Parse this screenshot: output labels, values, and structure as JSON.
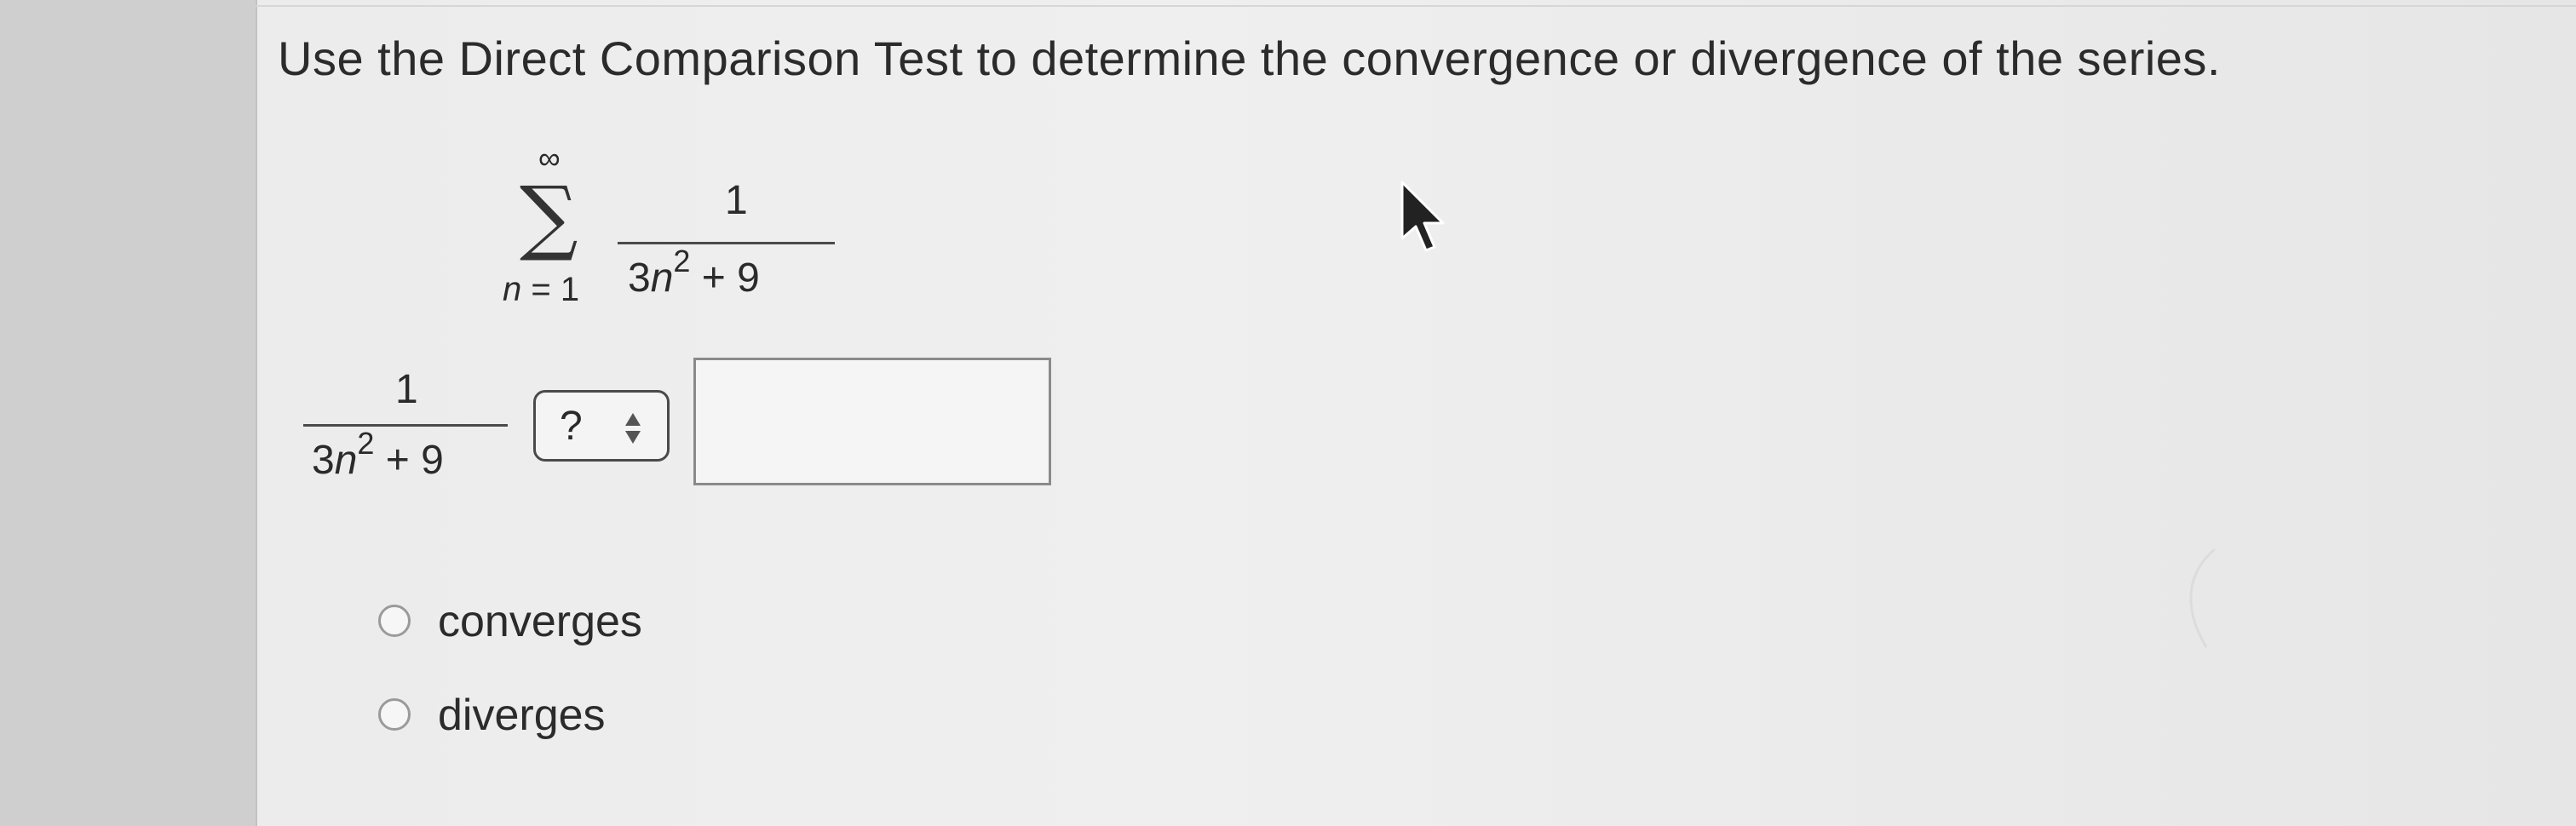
{
  "question": {
    "text": "Use the Direct Comparison Test to determine the convergence or divergence of the series."
  },
  "series": {
    "upper_limit": "∞",
    "index_var": "n",
    "index_start": " = 1",
    "numerator": "1",
    "den_coef": "3",
    "den_var": "n",
    "den_exp": "2",
    "den_rest": " + 9"
  },
  "comparison": {
    "numerator": "1",
    "den_coef": "3",
    "den_var": "n",
    "den_exp": "2",
    "den_rest": " + 9",
    "select_value": "?",
    "answer_value": ""
  },
  "options": [
    {
      "label": "converges",
      "selected": false
    },
    {
      "label": "diverges",
      "selected": false
    }
  ],
  "colors": {
    "panel": "#ececec",
    "text": "#2b2b2b",
    "border": "#4a4a4a"
  },
  "icons": {
    "cursor": "arrow-cursor-icon",
    "select": "up-down-arrows-icon"
  }
}
